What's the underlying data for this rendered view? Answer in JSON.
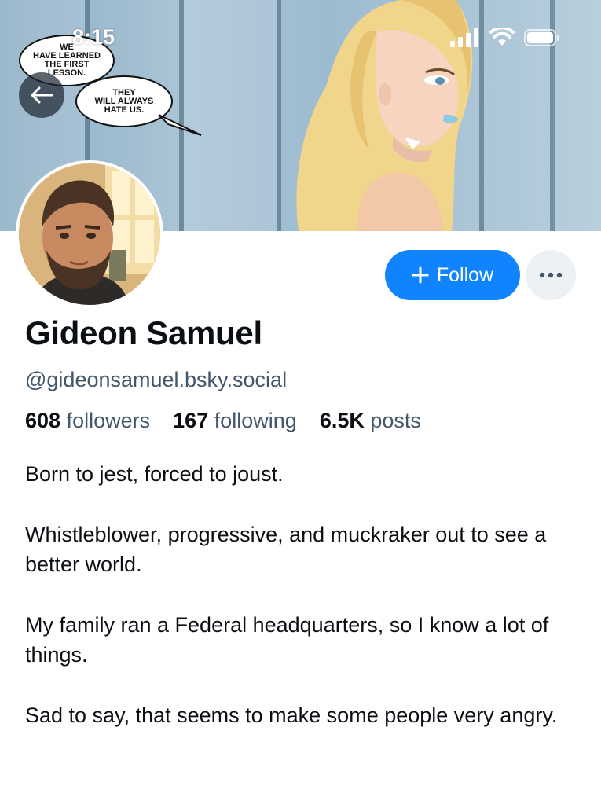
{
  "status_bar": {
    "time": "8:15"
  },
  "banner": {
    "bubble_one": "WE\nHAVE LEARNED\nTHE FIRST\nLESSON.",
    "bubble_two": "THEY\nWILL ALWAYS\nHATE US."
  },
  "profile": {
    "name": "Gideon Samuel",
    "handle": "@gideonsamuel.bsky.social",
    "follow_label": "Follow",
    "more_label": "...",
    "stats": {
      "followers_count": "608",
      "followers_label": "followers",
      "following_count": "167",
      "following_label": "following",
      "posts_count": "6.5K",
      "posts_label": "posts"
    },
    "bio": [
      "Born to jest, forced to joust.",
      "Whistleblower, progressive, and muckraker out to see a better world.",
      "My family ran a Federal headquarters, so I know a lot of things.",
      "Sad to say, that seems to make some people very angry."
    ]
  },
  "colors": {
    "accent": "#1083fe",
    "secondary_text": "#42576c",
    "primary_text": "#0b0f14"
  },
  "icons": [
    "back-arrow-icon",
    "signal-icon",
    "wifi-icon",
    "battery-icon",
    "plus-icon",
    "more-icon"
  ]
}
